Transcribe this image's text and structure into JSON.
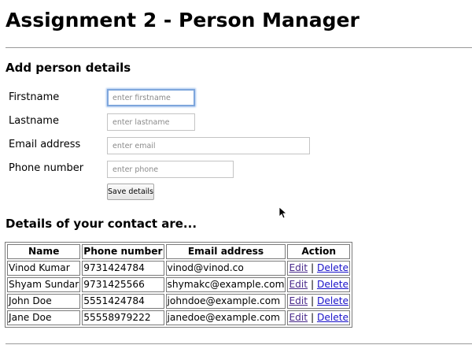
{
  "page": {
    "title": "Assignment 2 - Person Manager"
  },
  "form": {
    "heading": "Add person details",
    "firstname": {
      "label": "Firstname",
      "placeholder": "enter firstname",
      "value": ""
    },
    "lastname": {
      "label": "Lastname",
      "placeholder": "enter lastname",
      "value": ""
    },
    "email": {
      "label": "Email address",
      "placeholder": "enter email",
      "value": ""
    },
    "phone": {
      "label": "Phone number",
      "placeholder": "enter phone",
      "value": ""
    },
    "save_label": "Save details"
  },
  "contacts": {
    "heading": "Details of your contact are...",
    "columns": [
      "Name",
      "Phone number",
      "Email address",
      "Action"
    ],
    "rows": [
      {
        "name": "Vinod Kumar",
        "phone": "9731424784",
        "email": "vinod@vinod.co",
        "edit": "Edit",
        "sep": "|",
        "delete": "Delete"
      },
      {
        "name": "Shyam Sundar",
        "phone": "9731425566",
        "email": "shymakc@example.com",
        "edit": "Edit",
        "sep": "|",
        "delete": "Delete"
      },
      {
        "name": "John Doe",
        "phone": "5551424784",
        "email": "johndoe@example.com",
        "edit": "Edit",
        "sep": "|",
        "delete": "Delete"
      },
      {
        "name": "Jane Doe",
        "phone": "55558979222",
        "email": "janedoe@example.com",
        "edit": "Edit",
        "sep": "|",
        "delete": "Delete"
      }
    ]
  },
  "colors": {
    "focus_ring": "#7ea6dc",
    "visited_link": "#4a2a8b",
    "link": "#1a12c9"
  },
  "icons": {
    "cursor": "mouse-pointer-icon"
  }
}
